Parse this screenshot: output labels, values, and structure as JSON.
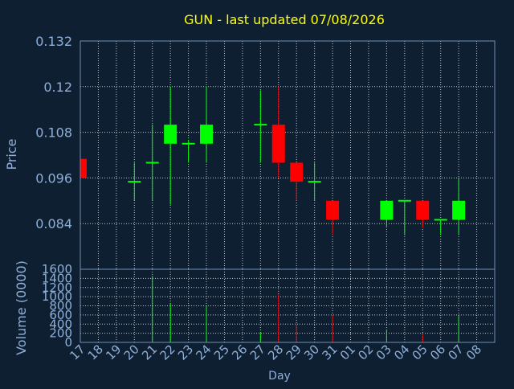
{
  "chart_data": {
    "type": "candlestick",
    "title": "GUN - last updated 07/08/2026",
    "xlabel": "Day",
    "ylabel": "Price",
    "volume_label": "Volume (0000)",
    "price_ylim": [
      0.072,
      0.132
    ],
    "price_ticks": [
      "0.132",
      "0.12",
      "0.108",
      "0.096",
      "0.084"
    ],
    "volume_ylim": [
      0,
      1600
    ],
    "volume_ticks": [
      "1600",
      "1400",
      "1200",
      "1000",
      "800",
      "600",
      "400",
      "200",
      "0"
    ],
    "x_labels": [
      "17",
      "18",
      "19",
      "20",
      "21",
      "22",
      "23",
      "24",
      "25",
      "26",
      "27",
      "28",
      "29",
      "30",
      "31",
      "01",
      "02",
      "03",
      "04",
      "05",
      "06",
      "07",
      "08"
    ],
    "colors": {
      "up": "#00ff00",
      "down": "#ff0000",
      "title": "#ffff00",
      "axis_text": "#8fb0d8",
      "grid": "#ffffff",
      "frame": "#6f8fb0"
    },
    "candles": [
      {
        "day": "17",
        "open": 0.101,
        "close": 0.096,
        "high": 0.101,
        "low": 0.096,
        "volume": 0
      },
      {
        "day": "20",
        "open": 0.095,
        "close": 0.095,
        "high": 0.1,
        "low": 0.09,
        "volume": 0
      },
      {
        "day": "21",
        "open": 0.1,
        "close": 0.1,
        "high": 0.11,
        "low": 0.09,
        "volume": 1450
      },
      {
        "day": "22",
        "open": 0.105,
        "close": 0.11,
        "high": 0.12,
        "low": 0.089,
        "volume": 850
      },
      {
        "day": "23",
        "open": 0.105,
        "close": 0.105,
        "high": 0.106,
        "low": 0.1,
        "volume": 0
      },
      {
        "day": "24",
        "open": 0.105,
        "close": 0.11,
        "high": 0.12,
        "low": 0.1,
        "volume": 800
      },
      {
        "day": "27",
        "open": 0.11,
        "close": 0.11,
        "high": 0.119,
        "low": 0.1,
        "volume": 230
      },
      {
        "day": "28",
        "open": 0.11,
        "close": 0.1,
        "high": 0.12,
        "low": 0.096,
        "volume": 1050
      },
      {
        "day": "29",
        "open": 0.1,
        "close": 0.095,
        "high": 0.1,
        "low": 0.09,
        "volume": 400
      },
      {
        "day": "30",
        "open": 0.095,
        "close": 0.095,
        "high": 0.1,
        "low": 0.09,
        "volume": 0
      },
      {
        "day": "31",
        "open": 0.09,
        "close": 0.085,
        "high": 0.09,
        "low": 0.081,
        "volume": 600
      },
      {
        "day": "03",
        "open": 0.085,
        "close": 0.09,
        "high": 0.09,
        "low": 0.083,
        "volume": 280
      },
      {
        "day": "04",
        "open": 0.09,
        "close": 0.09,
        "high": 0.09,
        "low": 0.081,
        "volume": 0
      },
      {
        "day": "05",
        "open": 0.09,
        "close": 0.085,
        "high": 0.09,
        "low": 0.083,
        "volume": 170
      },
      {
        "day": "06",
        "open": 0.085,
        "close": 0.085,
        "high": 0.085,
        "low": 0.081,
        "volume": 0
      },
      {
        "day": "07",
        "open": 0.085,
        "close": 0.09,
        "high": 0.096,
        "low": 0.081,
        "volume": 580
      }
    ]
  }
}
